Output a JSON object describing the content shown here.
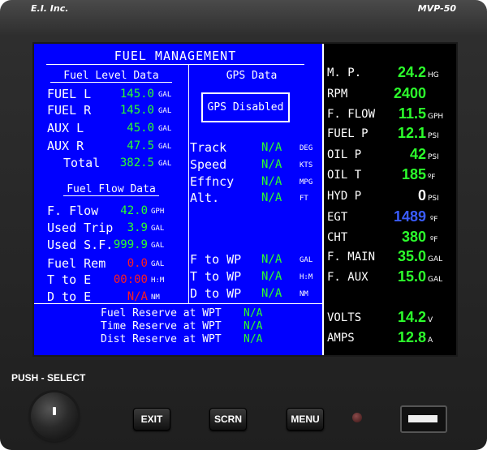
{
  "device": {
    "brand": "E.I. Inc.",
    "model": "MVP-50"
  },
  "screen": {
    "title": "FUEL MANAGEMENT",
    "fuel_level": {
      "heading": "Fuel Level Data",
      "rows": [
        {
          "label": "FUEL L",
          "value": "145.0",
          "unit": "GAL"
        },
        {
          "label": "FUEL R",
          "value": "145.0",
          "unit": "GAL"
        },
        {
          "label": "AUX L",
          "value": "45.0",
          "unit": "GAL"
        },
        {
          "label": "AUX R",
          "value": "47.5",
          "unit": "GAL"
        },
        {
          "label": "Total",
          "value": "382.5",
          "unit": "GAL"
        }
      ]
    },
    "fuel_flow": {
      "heading": "Fuel Flow Data",
      "rows": [
        {
          "label": "F. Flow",
          "value": "42.0",
          "unit": "GPH"
        },
        {
          "label": "Used Trip",
          "value": "3.9",
          "unit": "GAL"
        },
        {
          "label": "Used S.F.",
          "value": "999.9",
          "unit": "GAL"
        },
        {
          "label": "Fuel Rem",
          "value": "0.0",
          "unit": "GAL"
        },
        {
          "label": "T to E",
          "value": "00:00",
          "unit": "H:M"
        },
        {
          "label": "D to E",
          "value": "N/A",
          "unit": "NM"
        }
      ]
    },
    "gps": {
      "heading": "GPS Data",
      "status": "GPS Disabled",
      "rows": [
        {
          "label": "Track",
          "value": "N/A",
          "unit": "DEG"
        },
        {
          "label": "Speed",
          "value": "N/A",
          "unit": "KTS"
        },
        {
          "label": "Effncy",
          "value": "N/A",
          "unit": "MPG"
        },
        {
          "label": "Alt.",
          "value": "N/A",
          "unit": "FT"
        }
      ],
      "wp_rows": [
        {
          "label": "F to WP",
          "value": "N/A",
          "unit": "GAL"
        },
        {
          "label": "T to WP",
          "value": "N/A",
          "unit": "H:M"
        },
        {
          "label": "D to WP",
          "value": "N/A",
          "unit": "NM"
        }
      ]
    },
    "reserves": [
      {
        "label": "Fuel Reserve at WPT",
        "value": "N/A"
      },
      {
        "label": "Time Reserve at WPT",
        "value": "N/A"
      },
      {
        "label": "Dist Reserve at WPT",
        "value": "N/A"
      }
    ],
    "engine": [
      {
        "label": "M. P.",
        "value": "24.2",
        "unit": "HG"
      },
      {
        "label": "RPM",
        "value": "2400",
        "unit": ""
      },
      {
        "label": "F. FLOW",
        "value": "11.5",
        "unit": "GPH"
      },
      {
        "label": "FUEL P",
        "value": "12.1",
        "unit": "PSI"
      },
      {
        "label": "OIL P",
        "value": "42",
        "unit": "PSI"
      },
      {
        "label": "OIL T",
        "value": "185",
        "unit": "ºF"
      },
      {
        "label": "HYD P",
        "value": "0",
        "unit": "PSI"
      },
      {
        "label": "EGT",
        "value": "1489",
        "unit": "ºF"
      },
      {
        "label": "CHT",
        "value": "380",
        "unit": "ºF"
      },
      {
        "label": "F. MAIN",
        "value": "35.0",
        "unit": "GAL"
      },
      {
        "label": "F. AUX",
        "value": "15.0",
        "unit": "GAL"
      },
      {
        "label": "VOLTS",
        "value": "14.2",
        "unit": "V"
      },
      {
        "label": "AMPS",
        "value": "12.8",
        "unit": "A"
      }
    ]
  },
  "controls": {
    "push_select_label": "PUSH - SELECT",
    "exit_label": "EXIT",
    "scrn_label": "SCRN",
    "menu_label": "MENU"
  },
  "colors": {
    "screen_bg": "#0000ff",
    "value_green": "#2cff2c",
    "alert_red": "#ff1e1e",
    "egt_blue": "#3a5cff"
  }
}
